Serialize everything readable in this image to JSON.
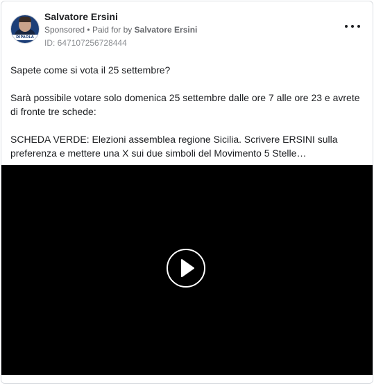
{
  "post": {
    "author_name": "Salvatore Ersini",
    "avatar_brand": "DIPAOLA",
    "sponsored_label": "Sponsored",
    "separator": "•",
    "paid_for_prefix": "Paid for by",
    "paid_for_name": "Salvatore Ersini",
    "ad_id": "ID: 647107256728444",
    "more_icon": "ellipsis-icon",
    "text": {
      "line1": "Sapete come si vota il 25 settembre?",
      "paragraph2": "Sarà possibile votare solo domenica 25 settembre dalle ore 7 alle ore 23 e avrete di fronte tre schede:",
      "paragraph3": "SCHEDA VERDE: Elezioni assemblea regione Sicilia. Scrivere ERSINI sulla preferenza e mettere una X sui due simboli del Movimento 5 Stelle…"
    },
    "video": {
      "background": "#000000",
      "play_icon": "play-icon"
    }
  }
}
